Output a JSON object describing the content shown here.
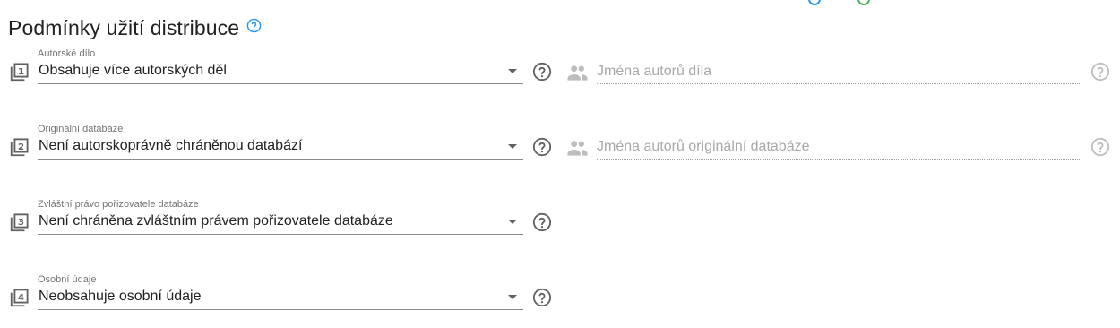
{
  "title": {
    "text": "Podmínky užití distribuce",
    "icon": "help-circle-icon",
    "icon_color": "#2196f3"
  },
  "colors": {
    "label": "#757575",
    "value": "#212121",
    "placeholder": "#a8a8a8",
    "icon": "#616161",
    "icon_disabled": "#bdbdbd"
  },
  "fields": [
    {
      "number": "1",
      "label": "Autorské dílo",
      "value": "Obsahuje více autorských děl",
      "authors_placeholder": "Jména autorů díla"
    },
    {
      "number": "2",
      "label": "Originální databáze",
      "value": "Není autorskoprávně chráněnou databází",
      "authors_placeholder": "Jména autorů originální databáze"
    },
    {
      "number": "3",
      "label": "Zvláštní právo pořizovatele databáze",
      "value": "Není chráněna zvláštním právem pořizovatele databáze"
    },
    {
      "number": "4",
      "label": "Osobní údaje",
      "value": "Neobsahuje osobní údaje"
    }
  ]
}
